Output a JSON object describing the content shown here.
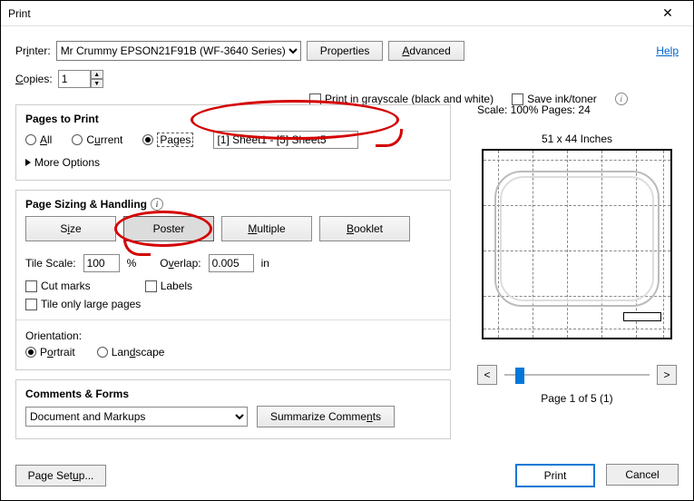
{
  "window": {
    "title": "Print"
  },
  "toolbar": {
    "printer_label": "Printer:",
    "printer_value": "Mr Crummy EPSON21F91B (WF-3640 Series)",
    "properties": "Properties",
    "advanced": "Advanced",
    "help": "Help"
  },
  "copies": {
    "label": "Copies:",
    "value": "1"
  },
  "options": {
    "grayscale": "Print in grayscale (black and white)",
    "save_ink": "Save ink/toner"
  },
  "pages": {
    "group": "Pages to Print",
    "all": "All",
    "current": "Current",
    "pages_radio": "Pages",
    "pages_value": "[1] Sheet1 - [5] Sheet5",
    "more": "More Options"
  },
  "sizing": {
    "group": "Page Sizing & Handling",
    "size": "Size",
    "poster": "Poster",
    "multiple": "Multiple",
    "booklet": "Booklet",
    "tile_scale_l": "Tile Scale:",
    "tile_scale_v": "100",
    "pct": "%",
    "overlap_l": "Overlap:",
    "overlap_v": "0.005",
    "overlap_u": "in",
    "cut": "Cut marks",
    "labels": "Labels",
    "tile_large": "Tile only large pages"
  },
  "orient": {
    "label": "Orientation:",
    "portrait": "Portrait",
    "landscape": "Landscape"
  },
  "comments": {
    "group": "Comments & Forms",
    "value": "Document and Markups",
    "summarize": "Summarize Comments"
  },
  "preview": {
    "scale": "Scale: 100% Pages: 24",
    "dims": "51 x 44 Inches",
    "prev": "<",
    "next": ">",
    "page_label": "Page 1 of 5 (1)"
  },
  "footer": {
    "page_setup": "Page Setup...",
    "print": "Print",
    "cancel": "Cancel"
  }
}
